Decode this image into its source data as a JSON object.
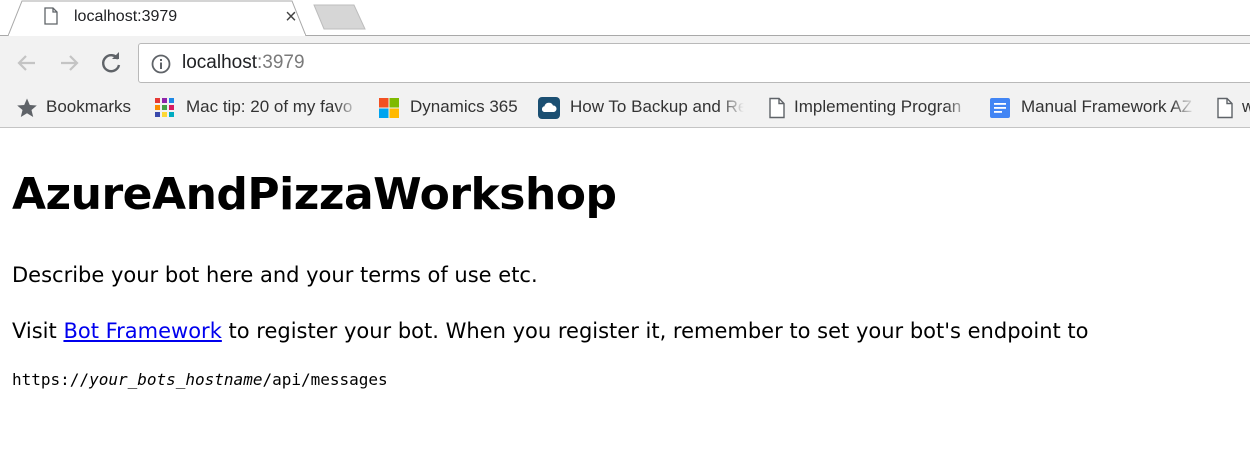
{
  "tab": {
    "title": "localhost:3979",
    "close_glyph": "×",
    "favicon": "page-icon"
  },
  "toolbar": {
    "back": "back-arrow-icon",
    "forward": "forward-arrow-icon",
    "reload": "reload-icon",
    "url_host": "localhost",
    "url_port": ":3979",
    "site_info": "info-icon"
  },
  "bookmarks": {
    "items": [
      {
        "label": "Bookmarks",
        "icon": "star-icon"
      },
      {
        "label": "Mac tip: 20 of my favo",
        "icon": "grid-colorful-icon"
      },
      {
        "label": "Dynamics 365",
        "icon": "microsoft-logo-icon"
      },
      {
        "label": "How To Backup and Re",
        "icon": "cloud-icon"
      },
      {
        "label": "Implementing Progran",
        "icon": "page-icon"
      },
      {
        "label": "Manual Framework AZ",
        "icon": "google-doc-icon"
      },
      {
        "label": "w",
        "icon": "page-icon"
      }
    ]
  },
  "page": {
    "heading": "AzureAndPizzaWorkshop",
    "description": "Describe your bot here and your terms of use etc.",
    "visit_prefix": "Visit ",
    "link_text": "Bot Framework",
    "visit_suffix": " to register your bot. When you register it, remember to set your bot's endpoint to",
    "endpoint_prefix": "https://",
    "endpoint_host": "your_bots_hostname",
    "endpoint_path": "/api/messages"
  },
  "colors": {
    "link": "#0000ee",
    "chrome_bg": "#f2f2f2",
    "url_port": "#7a7a7a"
  }
}
